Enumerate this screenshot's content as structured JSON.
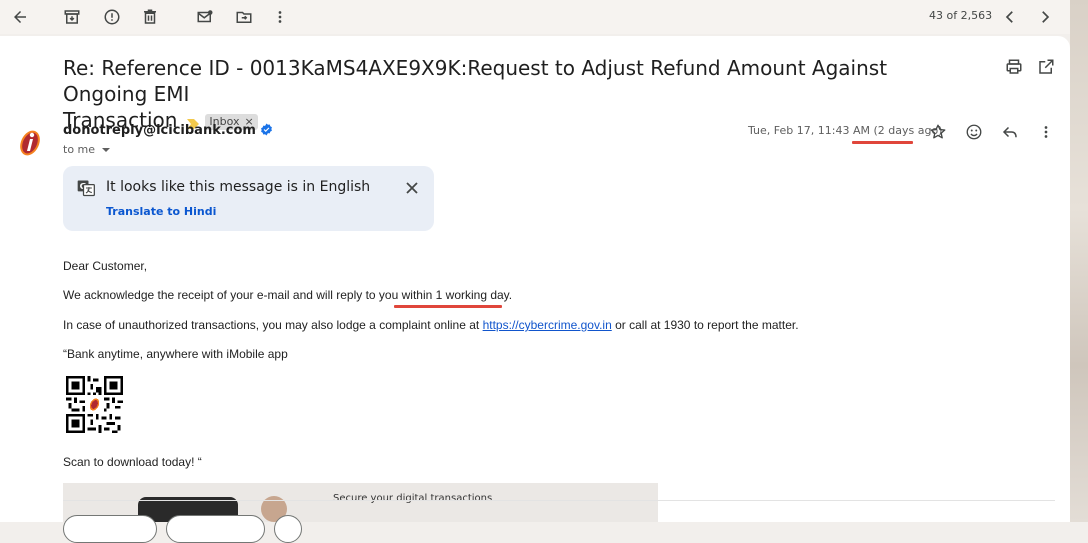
{
  "toolbar": {
    "icons": [
      "back-arrow-icon",
      "archive-icon",
      "report-spam-icon",
      "delete-icon",
      "mark-unread-icon",
      "move-to-icon",
      "more-vert-icon"
    ],
    "pager": "43 of 2,563"
  },
  "subject": {
    "line1": "Re: Reference ID - 0013KaMS4AXE9X9K:Request to Adjust Refund Amount Against Ongoing EMI",
    "line2": "Transaction",
    "label": "Inbox",
    "label_close": "×"
  },
  "sender": {
    "email": "donotreply@icicibank.com",
    "to": "to me",
    "date": "Tue, Feb 17, 11:43 AM",
    "relative": "(2 days ago)"
  },
  "translate": {
    "message": "It looks like this message is in English",
    "link": "Translate to Hindi"
  },
  "body": {
    "greeting": "Dear Customer,",
    "line1_pre": "We acknowledge the receipt of your e-mail and will reply to you ",
    "line1_hl": "within 1 working day.",
    "line2_pre": "In case of unauthorized transactions, you may also lodge a complaint online at ",
    "line2_link": "https://cybercrime.gov.in",
    "line2_post": " or call at 1930 to report the matter.",
    "line3": "“Bank anytime, anywhere with iMobile app",
    "line4": "Scan to download today! “",
    "promo_text": "Secure your digital transactions"
  },
  "colors": {
    "accent_red": "#e0463b",
    "link_blue": "#0b57d0",
    "brand_orange": "#f58220",
    "brand_red": "#b02a30"
  }
}
